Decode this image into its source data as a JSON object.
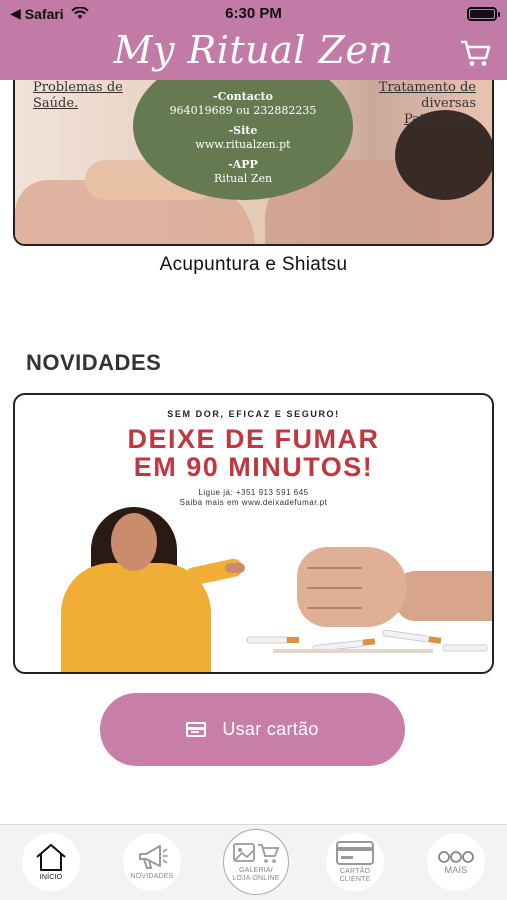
{
  "status_bar": {
    "back_app": "Safari",
    "time": "6:30 PM"
  },
  "header": {
    "title": "My Ritual Zen",
    "cart_icon": "shopping-cart-icon"
  },
  "hero": {
    "left_text": [
      "Problemas de",
      "Saúde."
    ],
    "right_text": [
      "Tratamento de",
      "diversas",
      "Patologias."
    ],
    "oval_lines": [
      "-Contacto",
      "964019689 ou 232882235",
      "-Site",
      "www.ritualzen.pt",
      "-APP",
      "Ritual Zen"
    ],
    "caption": "Acupuntura e Shiatsu"
  },
  "news": {
    "section_title": "NOVIDADES",
    "promo": {
      "tagline": "SEM DOR, EFICAZ E SEGURO!",
      "headline_1": "DEIXE DE FUMAR",
      "headline_2": "EM 90 MINUTOS!",
      "phone_line": "Ligue já: +351 913 591 645",
      "site_line": "Saiba mais em www.deixadefumar.pt"
    }
  },
  "use_card": {
    "label": "Usar cartão",
    "icon": "credit-card-icon"
  },
  "tabbar": {
    "items": [
      {
        "label": "INÍCIO",
        "icon": "home-icon",
        "active": true
      },
      {
        "label": "NOVIDADES",
        "icon": "megaphone-icon",
        "active": false
      },
      {
        "label_1": "GALERIA/",
        "label_2": "LOJA ONLINE",
        "icon": "gallery-cart-icon",
        "active": false
      },
      {
        "label_1": "CARTÃO",
        "label_2": "CLIENTE",
        "icon": "card-icon",
        "active": false
      },
      {
        "label": "MAIS",
        "icon": "more-icon",
        "active": false
      }
    ]
  },
  "colors": {
    "brand": "#c27aa7",
    "button": "#c77ea8",
    "oval": "#667a52",
    "headline": "#c0383f"
  }
}
